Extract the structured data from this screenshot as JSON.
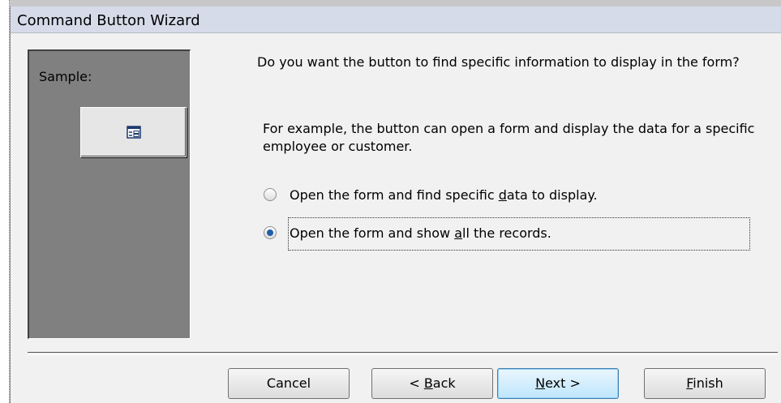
{
  "window": {
    "title": "Command Button Wizard"
  },
  "sample": {
    "label": "Sample:",
    "button_icon": "form-icon"
  },
  "question": "Do you want the button to find specific information to display in the form?",
  "example": "For example, the button can open a form and display the data for a specific employee or customer.",
  "options": [
    {
      "pre": "Open the form and find specific ",
      "u": "d",
      "post": "ata to display.",
      "selected": false
    },
    {
      "pre": "Open the form and show ",
      "u": "a",
      "post": "ll the records.",
      "selected": true
    }
  ],
  "buttons": {
    "cancel": "Cancel",
    "back": {
      "pre": "< ",
      "u": "B",
      "post": "ack"
    },
    "next": {
      "pre": "",
      "u": "N",
      "post": "ext >"
    },
    "finish": {
      "pre": "",
      "u": "F",
      "post": "inish"
    }
  },
  "colors": {
    "accent": "#1f5ea8",
    "panel": "#808080",
    "dialog_bg": "#f1f1f1"
  }
}
